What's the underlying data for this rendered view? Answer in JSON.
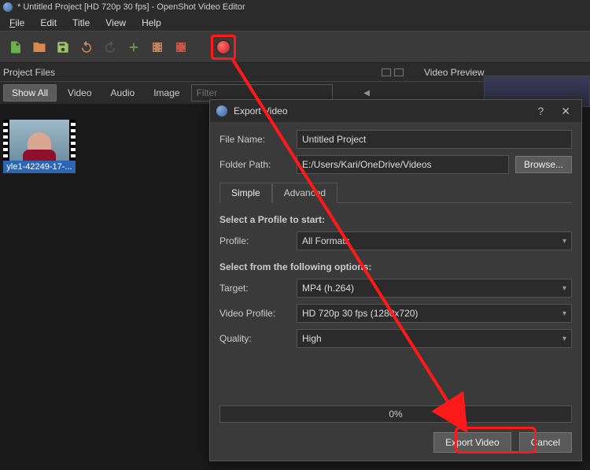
{
  "window": {
    "title": "* Untitled Project [HD 720p 30 fps] - OpenShot Video Editor"
  },
  "menu": {
    "file": "File",
    "edit": "Edit",
    "title": "Title",
    "view": "View",
    "help": "Help"
  },
  "panes": {
    "project_files": "Project Files",
    "video_preview": "Video Preview"
  },
  "pf_toolbar": {
    "show_all": "Show All",
    "video": "Video",
    "audio": "Audio",
    "image": "Image",
    "filter_placeholder": "Filter"
  },
  "thumbnail": {
    "caption": "yle1-42249-17-..."
  },
  "dialog": {
    "title": "Export Video",
    "file_name_label": "File Name:",
    "file_name_value": "Untitled Project",
    "folder_path_label": "Folder Path:",
    "folder_path_value": "E:/Users/Kari/OneDrive/Videos",
    "browse": "Browse...",
    "tabs": {
      "simple": "Simple",
      "advanced": "Advanced"
    },
    "section_profile": "Select a Profile to start:",
    "profile_label": "Profile:",
    "profile_value": "All Formats",
    "section_options": "Select from the following options:",
    "target_label": "Target:",
    "target_value": "MP4 (h.264)",
    "video_profile_label": "Video Profile:",
    "video_profile_value": "HD 720p 30 fps (1280x720)",
    "quality_label": "Quality:",
    "quality_value": "High",
    "progress": "0%",
    "export_btn": "Export Video",
    "cancel_btn": "Cancel"
  }
}
